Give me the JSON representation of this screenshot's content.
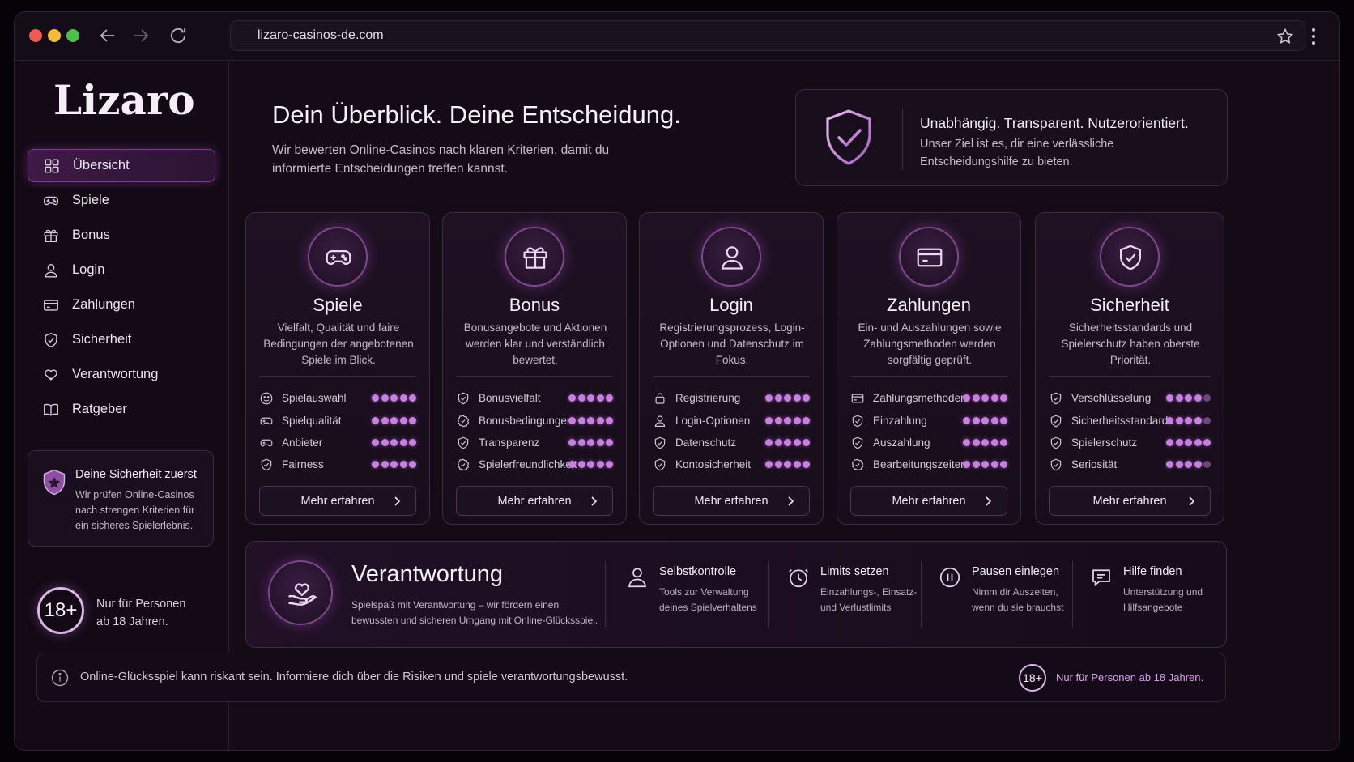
{
  "browser": {
    "url": "lizaro-casinos-de.com"
  },
  "sidebar": {
    "logo": "Lizaro",
    "items": [
      {
        "label": "Übersicht",
        "icon": "grid-icon",
        "active": true
      },
      {
        "label": "Spiele",
        "icon": "gamepad-icon"
      },
      {
        "label": "Bonus",
        "icon": "gift-icon"
      },
      {
        "label": "Login",
        "icon": "user-icon"
      },
      {
        "label": "Zahlungen",
        "icon": "card-icon"
      },
      {
        "label": "Sicherheit",
        "icon": "shield-icon"
      },
      {
        "label": "Verantwortung",
        "icon": "heart-hand-icon"
      },
      {
        "label": "Ratgeber",
        "icon": "book-icon"
      }
    ],
    "safety": {
      "title": "Deine Sicherheit zuerst",
      "text": "Wir prüfen Online-Casinos nach strengen Kriterien für ein sicheres Spielerlebnis."
    },
    "age": {
      "badge": "18+",
      "text": "Nur für Personen ab 18 Jahren."
    }
  },
  "header": {
    "title": "Dein Überblick. Deine Entscheidung.",
    "subtitle": "Wir bewerten Online-Casinos nach klaren Kriterien, damit du informierte Entscheidungen treffen kannst."
  },
  "trust": {
    "title": "Unabhängig. Transparent. Nutzerorientiert.",
    "text": "Unser Ziel ist es, dir eine verlässliche Entscheidungshilfe zu bieten."
  },
  "cards": [
    {
      "title": "Spiele",
      "icon": "gamepad-icon",
      "desc": "Vielfalt, Qualität und faire Bedingungen der angebotenen Spiele im Blick.",
      "criteria": [
        {
          "label": "Spielauswahl",
          "icon": "dice-icon",
          "rating": 5
        },
        {
          "label": "Spielqualität",
          "icon": "gamepad-icon",
          "rating": 5
        },
        {
          "label": "Anbieter",
          "icon": "gamepad-icon",
          "rating": 5
        },
        {
          "label": "Fairness",
          "icon": "shield-check-icon",
          "rating": 5
        }
      ],
      "button": "Mehr erfahren"
    },
    {
      "title": "Bonus",
      "icon": "gift-icon",
      "desc": "Bonusangebote und Aktionen werden klar und verständlich bewertet.",
      "criteria": [
        {
          "label": "Bonusvielfalt",
          "icon": "shield-check-icon",
          "rating": 5
        },
        {
          "label": "Bonusbedingungen",
          "icon": "badge-icon",
          "rating": 5
        },
        {
          "label": "Transparenz",
          "icon": "shield-check-icon",
          "rating": 5
        },
        {
          "label": "Spielerfreundlichkeit",
          "icon": "badge-icon",
          "rating": 5
        }
      ],
      "button": "Mehr erfahren"
    },
    {
      "title": "Login",
      "icon": "user-icon",
      "desc": "Registrierungsprozess, Login-Optionen und Datenschutz im Fokus.",
      "criteria": [
        {
          "label": "Registrierung",
          "icon": "lock-icon",
          "rating": 5
        },
        {
          "label": "Login-Optionen",
          "icon": "user-icon",
          "rating": 5
        },
        {
          "label": "Datenschutz",
          "icon": "shield-check-icon",
          "rating": 5
        },
        {
          "label": "Kontosicherheit",
          "icon": "shield-check-icon",
          "rating": 5
        }
      ],
      "button": "Mehr erfahren"
    },
    {
      "title": "Zahlungen",
      "icon": "card-icon",
      "desc": "Ein- und Auszahlungen sowie Zahlungsmethoden werden sorgfältig geprüft.",
      "criteria": [
        {
          "label": "Zahlungsmethoden",
          "icon": "card-icon",
          "rating": 5
        },
        {
          "label": "Einzahlung",
          "icon": "shield-check-icon",
          "rating": 5
        },
        {
          "label": "Auszahlung",
          "icon": "shield-check-icon",
          "rating": 5
        },
        {
          "label": "Bearbeitungszeiten",
          "icon": "badge-icon",
          "rating": 5
        }
      ],
      "button": "Mehr erfahren"
    },
    {
      "title": "Sicherheit",
      "icon": "shield-check-icon",
      "desc": "Sicherheitsstandards und Spielerschutz haben oberste Priorität.",
      "criteria": [
        {
          "label": "Verschlüsselung",
          "icon": "shield-check-icon",
          "rating": 4
        },
        {
          "label": "Sicherheitsstandards",
          "icon": "shield-check-icon",
          "rating": 4
        },
        {
          "label": "Spielerschutz",
          "icon": "shield-check-icon",
          "rating": 5
        },
        {
          "label": "Seriosität",
          "icon": "shield-check-icon",
          "rating": 4
        }
      ],
      "button": "Mehr erfahren"
    }
  ],
  "responsibility": {
    "title": "Verantwortung",
    "text": "Spielspaß mit Verantwortung – wir fördern einen bewussten und sicheren Umgang mit Online-Glücksspiel.",
    "features": [
      {
        "title": "Selbstkontrolle",
        "text": "Tools zur Verwaltung deines Spielverhaltens",
        "icon": "person-icon"
      },
      {
        "title": "Limits setzen",
        "text": "Einzahlungs-, Einsatz- und Verlustlimits",
        "icon": "clock-icon"
      },
      {
        "title": "Pausen einlegen",
        "text": "Nimm dir Auszeiten, wenn du sie brauchst",
        "icon": "pause-icon"
      },
      {
        "title": "Hilfe finden",
        "text": "Unterstützung und Hilfsangebote",
        "icon": "chat-icon"
      }
    ]
  },
  "footer": {
    "warning": "Online-Glücksspiel kann riskant sein. Informiere dich über die Risiken und spiele verantwortungsbewusst.",
    "age_badge": "18+",
    "age_text": "Nur für Personen ab 18 Jahren."
  },
  "colors": {
    "accent": "#c77fe0",
    "background": "#140b17",
    "border": "#3c2b42"
  }
}
